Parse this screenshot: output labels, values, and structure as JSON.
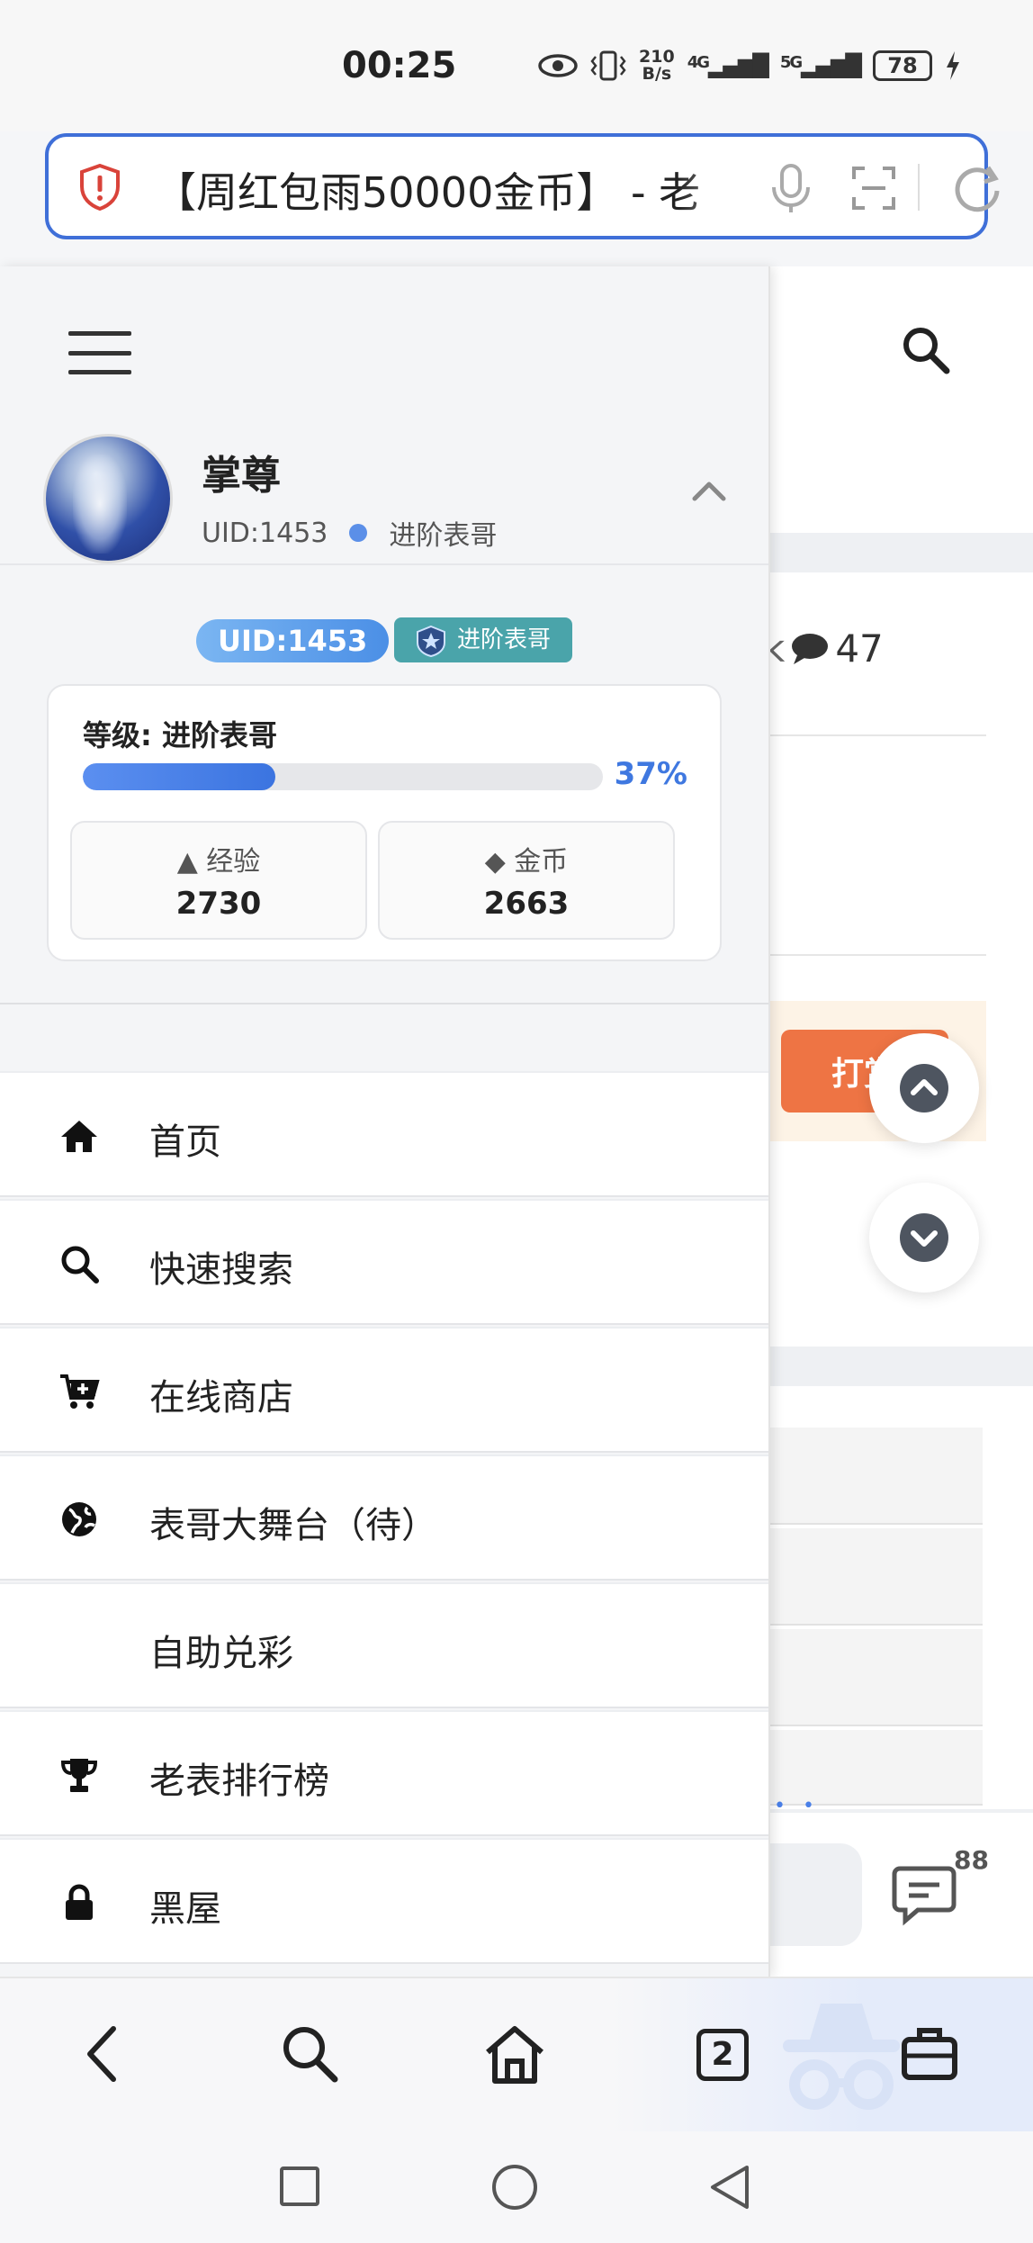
{
  "status_bar": {
    "time": "00:25",
    "net_speed_top": "210",
    "net_speed_unit": "B/s",
    "signal_4g": "4G",
    "signal_5g": "5G",
    "battery": "78"
  },
  "url_bar": {
    "text": "【周红包雨50000金币】 - 老"
  },
  "background_page": {
    "comment_count": "47",
    "partial_letter": "k",
    "tip_button_label": "打赏",
    "chat_badge_count": "88"
  },
  "drawer": {
    "profile": {
      "name": "掌尊",
      "uid_text": "UID:1453",
      "rank": "进阶表哥"
    },
    "badges": {
      "uid": "UID:1453",
      "rank": "进阶表哥"
    },
    "level": {
      "title": "等级: 进阶表哥",
      "progress_percent_label": "37%",
      "progress_fraction": 0.37,
      "exp_label": "▲ 经验",
      "exp_value": "2730",
      "coin_label": "◆ 金币",
      "coin_value": "2663"
    },
    "menu": [
      {
        "label": "首页",
        "icon": "home-icon"
      },
      {
        "label": "快速搜索",
        "icon": "search-icon"
      },
      {
        "label": "在线商店",
        "icon": "cart-plus-icon"
      },
      {
        "label": "表哥大舞台（待）",
        "icon": "globe-icon"
      },
      {
        "label": "自助兑彩",
        "icon": ""
      },
      {
        "label": "老表排行榜",
        "icon": "trophy-icon"
      },
      {
        "label": "黑屋",
        "icon": "lock-icon"
      }
    ]
  },
  "bottom_bar": {
    "tabs_count": "2"
  },
  "colors": {
    "accent": "#3f6fd8",
    "progress": "#3b74e0",
    "tip_orange": "#ee7444",
    "rank_badge": "#4aa4aa"
  }
}
